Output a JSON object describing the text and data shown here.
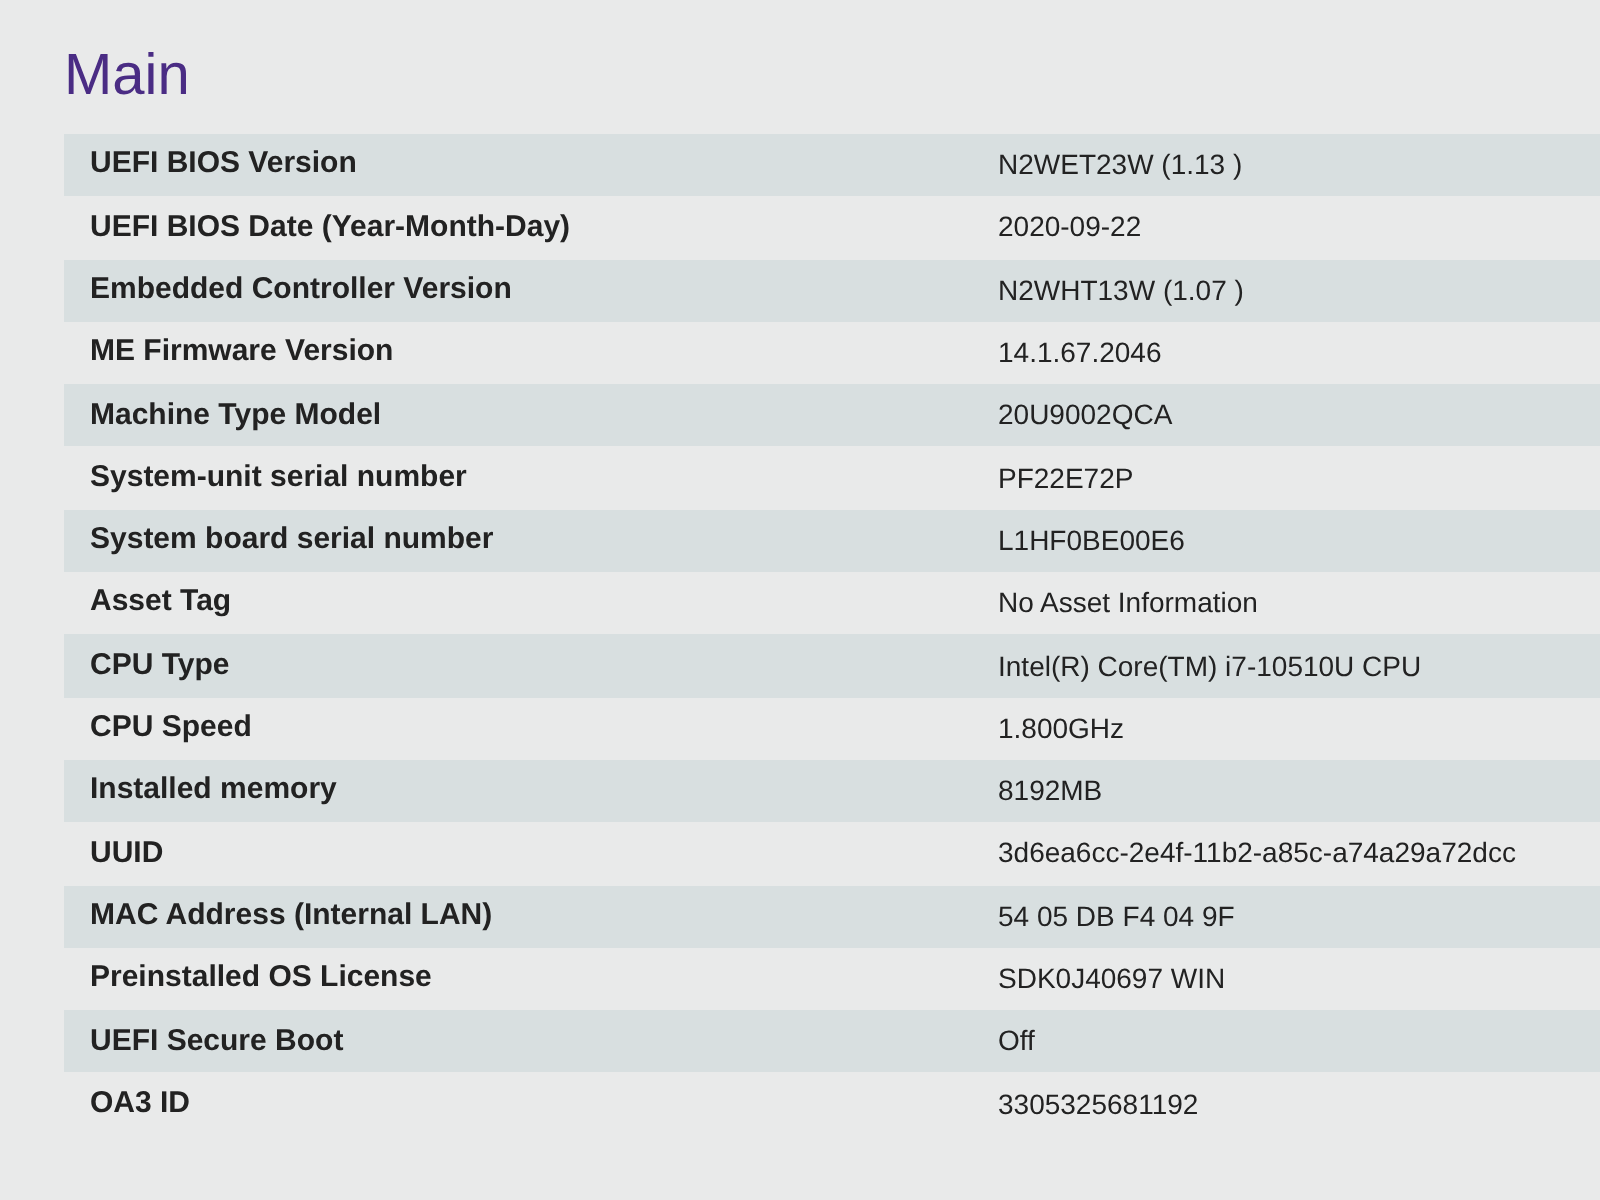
{
  "title": "Main",
  "rows": [
    {
      "label": "UEFI BIOS Version",
      "value": "N2WET23W (1.13 )"
    },
    {
      "label": "UEFI BIOS Date (Year-Month-Day)",
      "value": "2020-09-22"
    },
    {
      "label": "Embedded Controller Version",
      "value": "N2WHT13W (1.07 )"
    },
    {
      "label": "ME Firmware Version",
      "value": "14.1.67.2046"
    },
    {
      "label": "Machine Type Model",
      "value": "20U9002QCA"
    },
    {
      "label": "System-unit serial number",
      "value": "PF22E72P"
    },
    {
      "label": "System board serial number",
      "value": "L1HF0BE00E6"
    },
    {
      "label": "Asset Tag",
      "value": "No Asset Information"
    },
    {
      "label": "CPU Type",
      "value": "Intel(R) Core(TM) i7-10510U CPU"
    },
    {
      "label": "CPU Speed",
      "value": "1.800GHz"
    },
    {
      "label": "Installed memory",
      "value": "8192MB"
    },
    {
      "label": "UUID",
      "value": "3d6ea6cc-2e4f-11b2-a85c-a74a29a72dcc"
    },
    {
      "label": "MAC Address (Internal LAN)",
      "value": "54 05 DB F4 04 9F"
    },
    {
      "label": "Preinstalled OS License",
      "value": "SDK0J40697 WIN"
    },
    {
      "label": "UEFI Secure Boot",
      "value": "Off"
    },
    {
      "label": "OA3 ID",
      "value": "3305325681192"
    }
  ]
}
